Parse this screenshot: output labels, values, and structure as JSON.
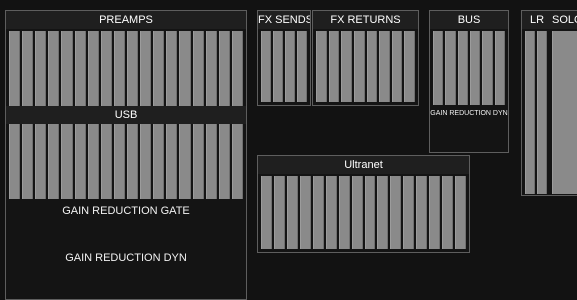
{
  "preamps": {
    "title": "PREAMPS",
    "meters": 18
  },
  "usb": {
    "title": "USB",
    "meters": 18,
    "gate_label": "GAIN REDUCTION GATE",
    "dyn_label": "GAIN REDUCTION DYN"
  },
  "fx_sends": {
    "title": "FX SENDS",
    "meters": 4
  },
  "fx_returns": {
    "title": "FX RETURNS",
    "meters": 8
  },
  "bus": {
    "title": "BUS",
    "meters": 6,
    "dyn_label": "GAIN REDUCTION DYN"
  },
  "lr": {
    "title": "LR",
    "meters": 2
  },
  "solo": {
    "title": "SOLO"
  },
  "ultranet": {
    "title": "Ultranet",
    "meters": 16
  },
  "colors": {
    "meter": "#8a8a8a",
    "background": "#121212",
    "border": "#5e5e5e"
  }
}
